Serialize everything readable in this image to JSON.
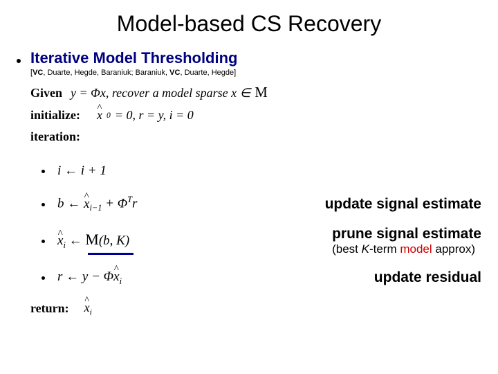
{
  "title": "Model-based CS Recovery",
  "subtitle": "Iterative Model Thresholding",
  "citation_parts": {
    "open": "[",
    "vc1": "VC",
    "mid1": ", Duarte, Hegde, Baraniuk; Baraniuk, ",
    "vc2": "VC",
    "mid2": ", Duarte, Hegde]",
    "close": ""
  },
  "given_label": "Given",
  "given_eq": "y = Φx,  recover a model sparse  x ∈ ",
  "given_set": "M",
  "init_label": "initialize:",
  "init_eq_parts": {
    "x0": "x",
    "eq1": " = 0,   r = y,   i = 0"
  },
  "iter_label": "iteration:",
  "steps": {
    "s1": "i ← i + 1",
    "s2_pre": "b ← ",
    "s2_x": "x",
    "s2_sub": "i−1",
    "s2_post": " + Φ",
    "s2_sup": "T",
    "s2_r": "r",
    "s3_x": "x",
    "s3_sub": "i",
    "s3_arrow": " ← ",
    "s3_M": "M",
    "s3_args": "(b, K)",
    "s4_pre": "r ← y − Φ",
    "s4_x": "x",
    "s4_sub": "i"
  },
  "labels": {
    "update_signal": "update signal estimate",
    "prune": "prune signal estimate",
    "prune_sub_open": "(",
    "prune_sub_best": "best ",
    "prune_sub_k": "K",
    "prune_sub_term": "-term ",
    "prune_sub_model": "model",
    "prune_sub_approx": " approx)",
    "update_residual": "update residual"
  },
  "return_label": "return:",
  "return_x": "x",
  "return_sub": "i"
}
